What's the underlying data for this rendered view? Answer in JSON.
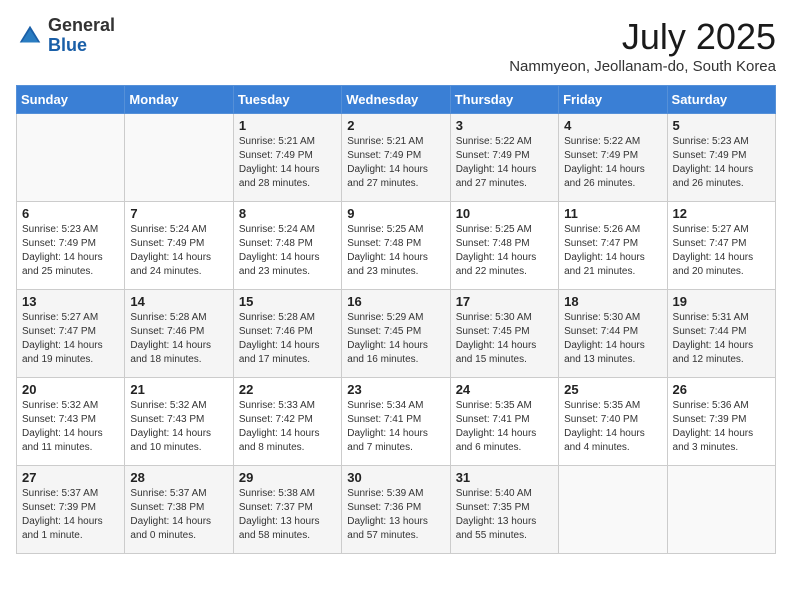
{
  "header": {
    "logo_general": "General",
    "logo_blue": "Blue",
    "month_year": "July 2025",
    "location": "Nammyeon, Jeollanam-do, South Korea"
  },
  "days_of_week": [
    "Sunday",
    "Monday",
    "Tuesday",
    "Wednesday",
    "Thursday",
    "Friday",
    "Saturday"
  ],
  "weeks": [
    [
      {
        "num": "",
        "sunrise": "",
        "sunset": "",
        "daylight": ""
      },
      {
        "num": "",
        "sunrise": "",
        "sunset": "",
        "daylight": ""
      },
      {
        "num": "1",
        "sunrise": "Sunrise: 5:21 AM",
        "sunset": "Sunset: 7:49 PM",
        "daylight": "Daylight: 14 hours and 28 minutes."
      },
      {
        "num": "2",
        "sunrise": "Sunrise: 5:21 AM",
        "sunset": "Sunset: 7:49 PM",
        "daylight": "Daylight: 14 hours and 27 minutes."
      },
      {
        "num": "3",
        "sunrise": "Sunrise: 5:22 AM",
        "sunset": "Sunset: 7:49 PM",
        "daylight": "Daylight: 14 hours and 27 minutes."
      },
      {
        "num": "4",
        "sunrise": "Sunrise: 5:22 AM",
        "sunset": "Sunset: 7:49 PM",
        "daylight": "Daylight: 14 hours and 26 minutes."
      },
      {
        "num": "5",
        "sunrise": "Sunrise: 5:23 AM",
        "sunset": "Sunset: 7:49 PM",
        "daylight": "Daylight: 14 hours and 26 minutes."
      }
    ],
    [
      {
        "num": "6",
        "sunrise": "Sunrise: 5:23 AM",
        "sunset": "Sunset: 7:49 PM",
        "daylight": "Daylight: 14 hours and 25 minutes."
      },
      {
        "num": "7",
        "sunrise": "Sunrise: 5:24 AM",
        "sunset": "Sunset: 7:49 PM",
        "daylight": "Daylight: 14 hours and 24 minutes."
      },
      {
        "num": "8",
        "sunrise": "Sunrise: 5:24 AM",
        "sunset": "Sunset: 7:48 PM",
        "daylight": "Daylight: 14 hours and 23 minutes."
      },
      {
        "num": "9",
        "sunrise": "Sunrise: 5:25 AM",
        "sunset": "Sunset: 7:48 PM",
        "daylight": "Daylight: 14 hours and 23 minutes."
      },
      {
        "num": "10",
        "sunrise": "Sunrise: 5:25 AM",
        "sunset": "Sunset: 7:48 PM",
        "daylight": "Daylight: 14 hours and 22 minutes."
      },
      {
        "num": "11",
        "sunrise": "Sunrise: 5:26 AM",
        "sunset": "Sunset: 7:47 PM",
        "daylight": "Daylight: 14 hours and 21 minutes."
      },
      {
        "num": "12",
        "sunrise": "Sunrise: 5:27 AM",
        "sunset": "Sunset: 7:47 PM",
        "daylight": "Daylight: 14 hours and 20 minutes."
      }
    ],
    [
      {
        "num": "13",
        "sunrise": "Sunrise: 5:27 AM",
        "sunset": "Sunset: 7:47 PM",
        "daylight": "Daylight: 14 hours and 19 minutes."
      },
      {
        "num": "14",
        "sunrise": "Sunrise: 5:28 AM",
        "sunset": "Sunset: 7:46 PM",
        "daylight": "Daylight: 14 hours and 18 minutes."
      },
      {
        "num": "15",
        "sunrise": "Sunrise: 5:28 AM",
        "sunset": "Sunset: 7:46 PM",
        "daylight": "Daylight: 14 hours and 17 minutes."
      },
      {
        "num": "16",
        "sunrise": "Sunrise: 5:29 AM",
        "sunset": "Sunset: 7:45 PM",
        "daylight": "Daylight: 14 hours and 16 minutes."
      },
      {
        "num": "17",
        "sunrise": "Sunrise: 5:30 AM",
        "sunset": "Sunset: 7:45 PM",
        "daylight": "Daylight: 14 hours and 15 minutes."
      },
      {
        "num": "18",
        "sunrise": "Sunrise: 5:30 AM",
        "sunset": "Sunset: 7:44 PM",
        "daylight": "Daylight: 14 hours and 13 minutes."
      },
      {
        "num": "19",
        "sunrise": "Sunrise: 5:31 AM",
        "sunset": "Sunset: 7:44 PM",
        "daylight": "Daylight: 14 hours and 12 minutes."
      }
    ],
    [
      {
        "num": "20",
        "sunrise": "Sunrise: 5:32 AM",
        "sunset": "Sunset: 7:43 PM",
        "daylight": "Daylight: 14 hours and 11 minutes."
      },
      {
        "num": "21",
        "sunrise": "Sunrise: 5:32 AM",
        "sunset": "Sunset: 7:43 PM",
        "daylight": "Daylight: 14 hours and 10 minutes."
      },
      {
        "num": "22",
        "sunrise": "Sunrise: 5:33 AM",
        "sunset": "Sunset: 7:42 PM",
        "daylight": "Daylight: 14 hours and 8 minutes."
      },
      {
        "num": "23",
        "sunrise": "Sunrise: 5:34 AM",
        "sunset": "Sunset: 7:41 PM",
        "daylight": "Daylight: 14 hours and 7 minutes."
      },
      {
        "num": "24",
        "sunrise": "Sunrise: 5:35 AM",
        "sunset": "Sunset: 7:41 PM",
        "daylight": "Daylight: 14 hours and 6 minutes."
      },
      {
        "num": "25",
        "sunrise": "Sunrise: 5:35 AM",
        "sunset": "Sunset: 7:40 PM",
        "daylight": "Daylight: 14 hours and 4 minutes."
      },
      {
        "num": "26",
        "sunrise": "Sunrise: 5:36 AM",
        "sunset": "Sunset: 7:39 PM",
        "daylight": "Daylight: 14 hours and 3 minutes."
      }
    ],
    [
      {
        "num": "27",
        "sunrise": "Sunrise: 5:37 AM",
        "sunset": "Sunset: 7:39 PM",
        "daylight": "Daylight: 14 hours and 1 minute."
      },
      {
        "num": "28",
        "sunrise": "Sunrise: 5:37 AM",
        "sunset": "Sunset: 7:38 PM",
        "daylight": "Daylight: 14 hours and 0 minutes."
      },
      {
        "num": "29",
        "sunrise": "Sunrise: 5:38 AM",
        "sunset": "Sunset: 7:37 PM",
        "daylight": "Daylight: 13 hours and 58 minutes."
      },
      {
        "num": "30",
        "sunrise": "Sunrise: 5:39 AM",
        "sunset": "Sunset: 7:36 PM",
        "daylight": "Daylight: 13 hours and 57 minutes."
      },
      {
        "num": "31",
        "sunrise": "Sunrise: 5:40 AM",
        "sunset": "Sunset: 7:35 PM",
        "daylight": "Daylight: 13 hours and 55 minutes."
      },
      {
        "num": "",
        "sunrise": "",
        "sunset": "",
        "daylight": ""
      },
      {
        "num": "",
        "sunrise": "",
        "sunset": "",
        "daylight": ""
      }
    ]
  ]
}
